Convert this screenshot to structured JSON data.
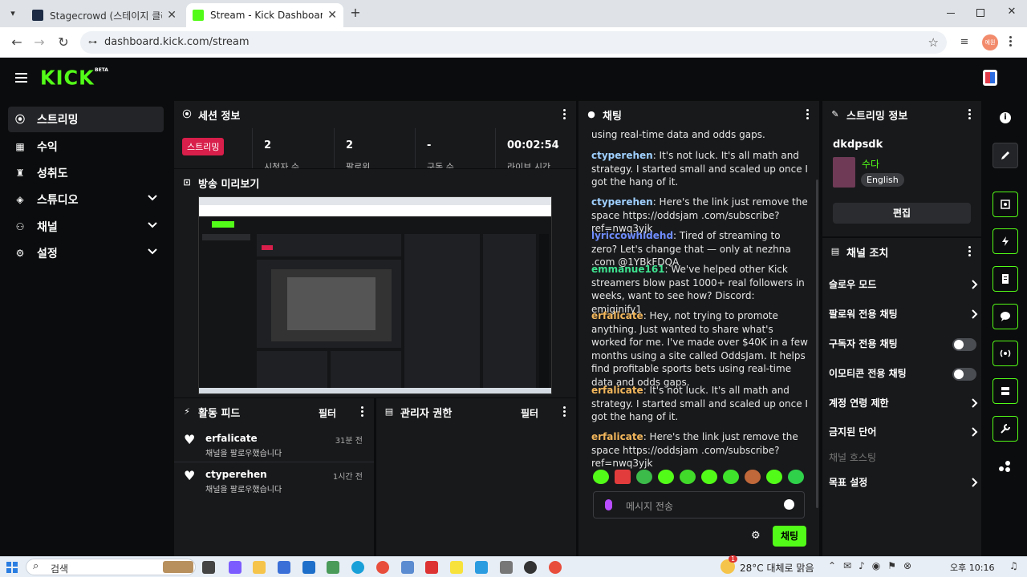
{
  "browser": {
    "tabs": [
      {
        "title": "Stagecrowd (스테이지 클라우드)",
        "active": false
      },
      {
        "title": "Stream - Kick Dashboard",
        "active": true
      }
    ],
    "url": "dashboard.kick.com/stream",
    "profile_badge": "예원"
  },
  "brand": {
    "logo": "KICK",
    "beta": "BETA",
    "accent": "#53fc18"
  },
  "sidebar": {
    "items": [
      {
        "label": "스트리밍",
        "icon": "broadcast-icon",
        "active": true
      },
      {
        "label": "수익",
        "icon": "chart-icon"
      },
      {
        "label": "성취도",
        "icon": "trophy-icon"
      },
      {
        "label": "스튜디오",
        "icon": "studio-icon"
      },
      {
        "label": "채널",
        "icon": "channel-icon"
      },
      {
        "label": "설정",
        "icon": "gear-icon"
      }
    ]
  },
  "session": {
    "title": "세션 정보",
    "live_badge": "스트리밍",
    "stats": [
      {
        "value": "2",
        "label": "시청자 수"
      },
      {
        "value": "2",
        "label": "팔로워"
      },
      {
        "value": "-",
        "label": "구독 수"
      },
      {
        "value": "00:02:54",
        "label": "라이브 시간"
      }
    ]
  },
  "preview": {
    "title": "방송 미리보기"
  },
  "activity": {
    "title": "활동 피드",
    "filter": "필터",
    "items": [
      {
        "user": "erfalicate",
        "text": "채널을 팔로우했습니다",
        "time": "31분 전"
      },
      {
        "user": "ctyperehen",
        "text": "채널을 팔로우했습니다",
        "time": "1시간 전"
      }
    ]
  },
  "mods": {
    "title": "관리자 권한",
    "filter": "필터"
  },
  "chat": {
    "title": "채팅",
    "top_fragment": "using real-time data and odds gaps.",
    "messages": [
      {
        "user": "ctyperehen",
        "color": "#9fd0ff",
        "text": "It's not luck. It's all math and strategy. I started small and scaled up once I got the hang of it."
      },
      {
        "user": "ctyperehen",
        "color": "#9fd0ff",
        "text": "Here's the link just remove the space https://oddsjam .com/subscribe?ref=nwq3yjk"
      },
      {
        "user": "lyriccowhidehd",
        "color": "#6f8dff",
        "text": "Tired of streaming to zero? Let's change that — only at nezhna .com @1YBkFDQA"
      },
      {
        "user": "emmanue161",
        "color": "#3ee28f",
        "text": "We've helped other Kick streamers blow past 1000+ real followers in weeks, want to see how? Discord: emiginify1"
      },
      {
        "user": "erfalicate",
        "color": "#f2b65b",
        "text": "Hey, not trying to promote anything. Just wanted to share what's worked for me. I've made over $40K in a few months using a site called OddsJam. It helps find profitable sports bets using real-time data and odds gaps."
      },
      {
        "user": "erfalicate",
        "color": "#f2b65b",
        "text": "It's not luck. It's all math and strategy. I started small and scaled up once I got the hang of it."
      },
      {
        "user": "erfalicate",
        "color": "#f2b65b",
        "text": "Here's the link just remove the space https://oddsjam .com/subscribe?ref=nwq3yjk"
      }
    ],
    "input_placeholder": "메시지 전송",
    "send_label": "채팅"
  },
  "stream_info": {
    "title": "스트리밍 정보",
    "channel": "dkdpsdk",
    "category": "수다",
    "language": "English",
    "edit_label": "편집"
  },
  "channel_actions": {
    "title": "채널 조치",
    "items": [
      {
        "label": "슬로우 모드",
        "type": "arrow"
      },
      {
        "label": "팔로워 전용 채팅",
        "type": "arrow"
      },
      {
        "label": "구독자 전용 채팅",
        "type": "toggle"
      },
      {
        "label": "이모티콘 전용 채팅",
        "type": "toggle"
      },
      {
        "label": "계정 연령 제한",
        "type": "arrow"
      },
      {
        "label": "금지된 단어",
        "type": "arrow"
      },
      {
        "label": "채널 호스팅",
        "type": "disabled"
      },
      {
        "label": "목표 설정",
        "type": "arrow"
      }
    ]
  },
  "taskbar": {
    "search": "검색",
    "weather": "28°C 대체로 맑음",
    "time": "오후 10:16",
    "notif_count": "1"
  }
}
